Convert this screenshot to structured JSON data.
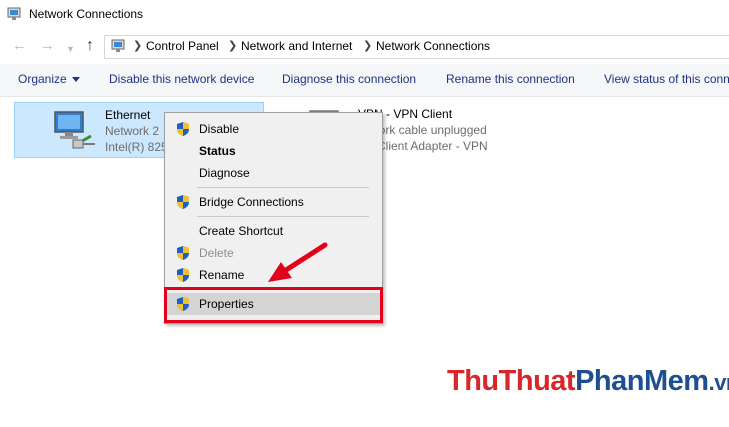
{
  "window": {
    "title": "Network Connections"
  },
  "address": {
    "crumbs": [
      "Control Panel",
      "Network and Internet",
      "Network Connections"
    ]
  },
  "toolbar": {
    "organize": "Organize",
    "disable": "Disable this network device",
    "diagnose": "Diagnose this connection",
    "rename": "Rename this connection",
    "view_status": "View status of this conn"
  },
  "connections": [
    {
      "name": "Ethernet",
      "status": "Network 2",
      "adapter": "Intel(R) 825"
    },
    {
      "name": "VPN - VPN Client",
      "status": "work cable unplugged",
      "adapter": "Client Adapter - VPN"
    }
  ],
  "context_menu": {
    "items": [
      {
        "label": "Disable",
        "icon": "shield-icon",
        "style": "normal"
      },
      {
        "label": "Status",
        "icon": "",
        "style": "bold"
      },
      {
        "label": "Diagnose",
        "icon": "",
        "style": "normal"
      },
      {
        "label": "Bridge Connections",
        "icon": "shield-icon",
        "style": "normal"
      },
      {
        "label": "Create Shortcut",
        "icon": "",
        "style": "normal"
      },
      {
        "label": "Delete",
        "icon": "shield-icon",
        "style": "disabled"
      },
      {
        "label": "Rename",
        "icon": "shield-icon",
        "style": "normal"
      },
      {
        "label": "Properties",
        "icon": "shield-icon",
        "style": "highlighted"
      }
    ]
  },
  "watermark": {
    "part1": "Thu",
    "part2": "Thuat",
    "part3": "Phan",
    "part4": "Mem",
    "part5": ".vn"
  },
  "colors": {
    "accent_red": "#e3001b",
    "toolbar_text": "#1e3287",
    "selection": "#cce8ff",
    "watermark_red": "#d9262a"
  }
}
